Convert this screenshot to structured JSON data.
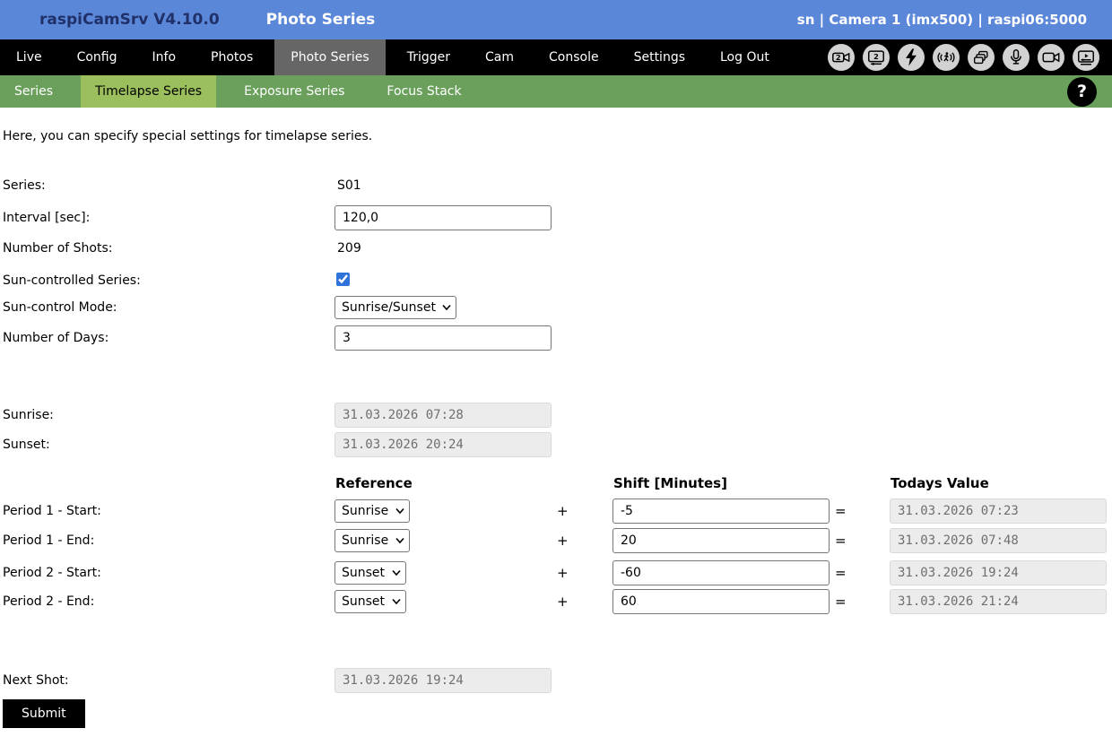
{
  "header": {
    "app_title": "raspiCamSrv V4.10.0",
    "page_title": "Photo Series",
    "status": "sn | Camera 1 (imx500) | raspi06:5000"
  },
  "nav": {
    "items": [
      {
        "label": "Live"
      },
      {
        "label": "Config"
      },
      {
        "label": "Info"
      },
      {
        "label": "Photos"
      },
      {
        "label": "Photo Series",
        "active": true
      },
      {
        "label": "Trigger"
      },
      {
        "label": "Cam"
      },
      {
        "label": "Console"
      },
      {
        "label": "Settings"
      },
      {
        "label": "Log Out"
      }
    ],
    "icons": [
      "camera-2",
      "display-2",
      "flash",
      "motion-detection",
      "photo-stack",
      "microphone",
      "video-camera",
      "media-player"
    ]
  },
  "subnav": {
    "items": [
      {
        "label": "Series"
      },
      {
        "label": "Timelapse Series",
        "active": true
      },
      {
        "label": "Exposure Series"
      },
      {
        "label": "Focus Stack"
      }
    ],
    "help_label": "?"
  },
  "intro": "Here, you can specify special settings for timelapse series.",
  "form": {
    "series": {
      "label": "Series:",
      "value": "S01"
    },
    "interval": {
      "label": "Interval [sec]:",
      "value": "120,0"
    },
    "shots": {
      "label": "Number of Shots:",
      "value": "209"
    },
    "sun_controlled": {
      "label": "Sun-controlled Series:",
      "checked": true
    },
    "sun_mode": {
      "label": "Sun-control Mode:",
      "value": "Sunrise/Sunset"
    },
    "days": {
      "label": "Number of Days:",
      "value": "3"
    },
    "sunrise": {
      "label": "Sunrise:",
      "value": "31.03.2026 07:28"
    },
    "sunset": {
      "label": "Sunset:",
      "value": "31.03.2026 20:24"
    },
    "columns": {
      "reference": "Reference",
      "shift": "Shift [Minutes]",
      "todays": "Todays Value"
    },
    "plus": "+",
    "equals": "=",
    "periods": [
      {
        "label": "Period 1 - Start:",
        "reference": "Sunrise",
        "shift": "-5",
        "todays": "31.03.2026 07:23"
      },
      {
        "label": "Period 1 - End:",
        "reference": "Sunrise",
        "shift": "20",
        "todays": "31.03.2026 07:48"
      },
      {
        "label": "Period 2 - Start:",
        "reference": "Sunset",
        "shift": "-60",
        "todays": "31.03.2026 19:24"
      },
      {
        "label": "Period 2 - End:",
        "reference": "Sunset",
        "shift": "60",
        "todays": "31.03.2026 21:24"
      }
    ],
    "next_shot": {
      "label": "Next Shot:",
      "value": "31.03.2026 19:24"
    },
    "submit_label": "Submit"
  },
  "colors": {
    "topbar_bg": "#5b87d9",
    "topbar_title": "#203068",
    "nav_bg": "#000000",
    "nav_active_bg": "#666666",
    "subnav_bg": "#6aa05c",
    "subnav_active_bg": "#9abf5c",
    "checkbox_accent": "#2f72d9",
    "disabled_input_bg": "#ececec",
    "disabled_input_text": "#6f6f6f"
  }
}
